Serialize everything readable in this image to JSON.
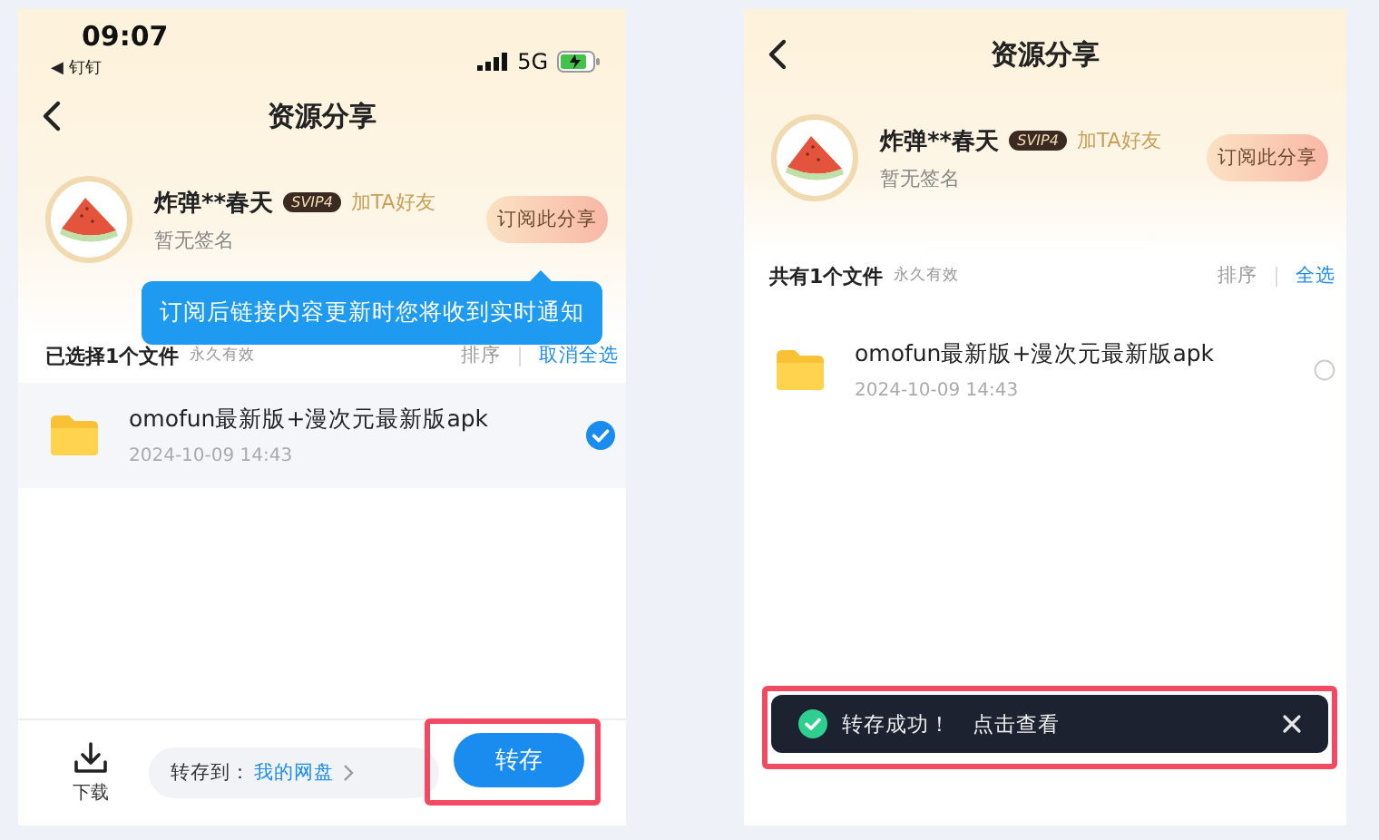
{
  "screens": [
    {
      "status_bar": {
        "time": "09:07",
        "back_app": "◀ 钉钉",
        "network": "5G"
      },
      "header": {
        "title": "资源分享"
      },
      "profile": {
        "name": "炸弹**春天",
        "badge": "SVIP4",
        "add_friend": "加TA好友",
        "signature": "暂无签名",
        "subscribe_button": "订阅此分享"
      },
      "tooltip": "订阅后链接内容更新时您将收到实时通知",
      "list_header": {
        "summary": "已选择1个文件",
        "validity": "永久有效",
        "sort": "排序",
        "select_action": "取消全选"
      },
      "files": [
        {
          "name": "omofun最新版+漫次元最新版apk",
          "date": "2024-10-09 14:43",
          "selected": true
        }
      ],
      "bottom_bar": {
        "download": "下载",
        "save_to_label": "转存到：",
        "save_to_target": "我的网盘",
        "save_button": "转存",
        "highlighted": true
      }
    },
    {
      "header": {
        "title": "资源分享"
      },
      "profile": {
        "name": "炸弹**春天",
        "badge": "SVIP4",
        "add_friend": "加TA好友",
        "signature": "暂无签名",
        "subscribe_button": "订阅此分享"
      },
      "list_header": {
        "summary": "共有1个文件",
        "validity": "永久有效",
        "sort": "排序",
        "select_action": "全选"
      },
      "files": [
        {
          "name": "omofun最新版+漫次元最新版apk",
          "date": "2024-10-09 14:43",
          "selected": false
        }
      ],
      "toast": {
        "text": "转存成功！",
        "action": "点击查看",
        "highlighted": true
      }
    }
  ]
}
